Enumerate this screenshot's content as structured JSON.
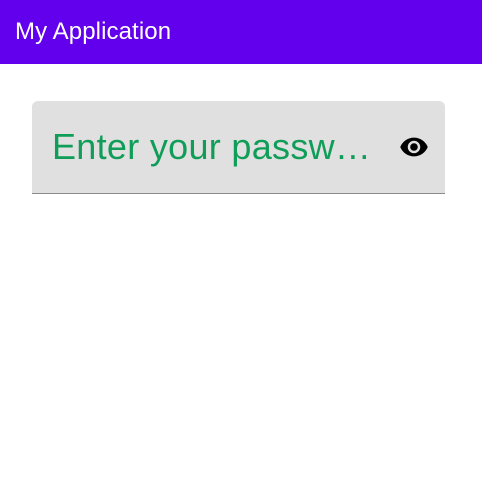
{
  "app_bar": {
    "title": "My Application",
    "color": "#6200EE"
  },
  "password_field": {
    "placeholder": "Enter your passw…",
    "value": "",
    "text_color": "#0F9D58",
    "background": "#E0E0E0",
    "toggle_icon": "visibility-icon"
  }
}
